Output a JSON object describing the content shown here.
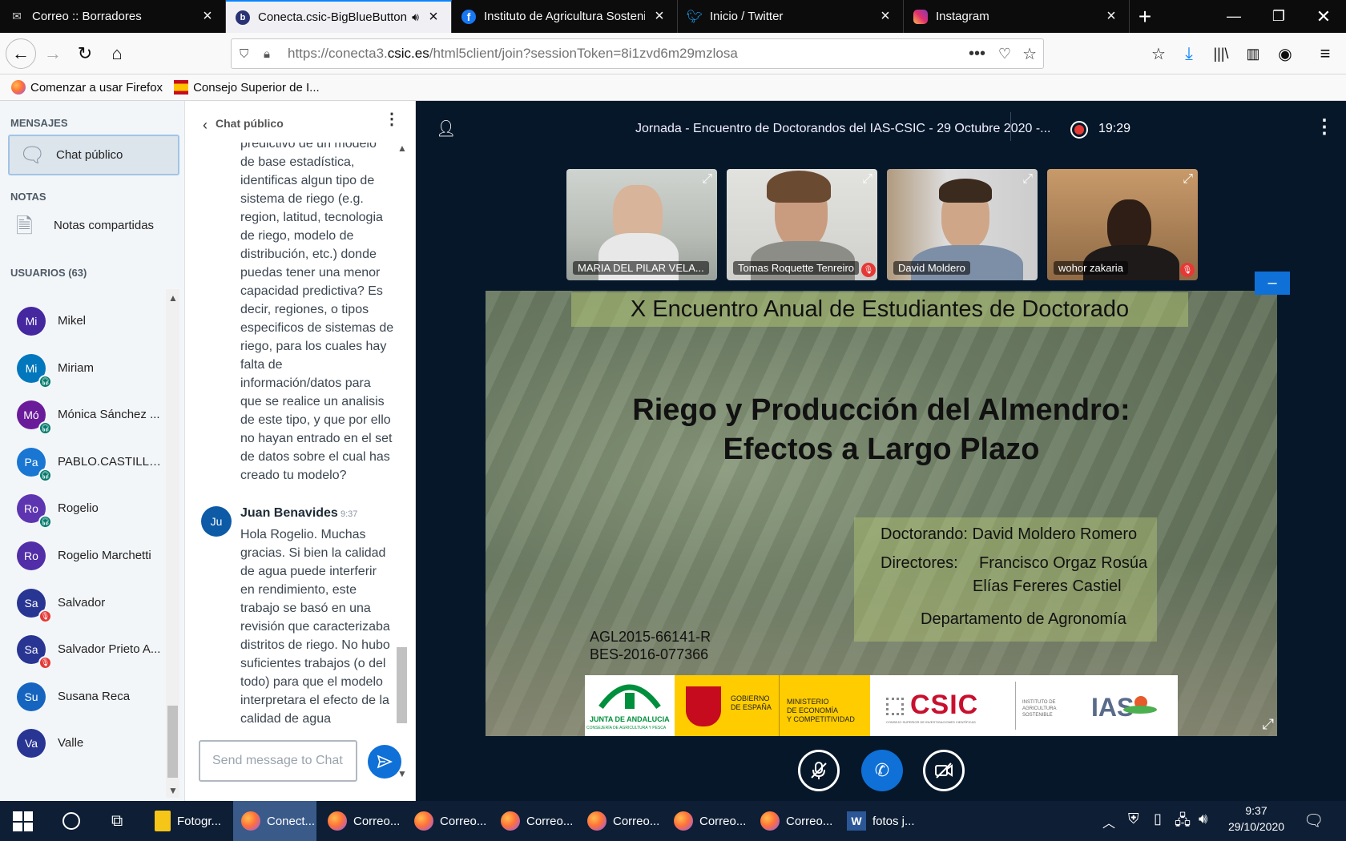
{
  "tabs": [
    {
      "title": "Correo :: Borradores",
      "icon": "mail-icon",
      "active": false
    },
    {
      "title": "Conecta.csic-BigBlueButton",
      "icon": "bigbluebutton-icon",
      "active": true
    },
    {
      "title": "Instituto de Agricultura Sostenible",
      "icon": "facebook-icon",
      "active": false
    },
    {
      "title": "Inicio / Twitter",
      "icon": "twitter-icon",
      "active": false
    },
    {
      "title": "Instagram",
      "icon": "instagram-icon",
      "active": false
    }
  ],
  "url": {
    "prefix": "https://conecta3.",
    "domain": "csic.es",
    "path": "/html5client/join?sessionToken=8i1zvd6m29mzlosa"
  },
  "bookmarks": [
    {
      "label": "Comenzar a usar Firefox",
      "icon": "firefox-icon"
    },
    {
      "label": "Consejo Superior de I...",
      "icon": "spain-flag-icon"
    }
  ],
  "sidebar": {
    "messages_header": "MENSAJES",
    "public_chat": "Chat público",
    "notes_header": "NOTAS",
    "shared_notes": "Notas compartidas",
    "users_header": "USUARIOS (63)",
    "users": [
      {
        "initials": "Mi",
        "name": "Mikel",
        "color": "#4527a0",
        "badge": ""
      },
      {
        "initials": "Mi",
        "name": "Miriam",
        "color": "#0277bd",
        "badge": "headset"
      },
      {
        "initials": "Mó",
        "name": "Mónica Sánchez ...",
        "color": "#6a1b9a",
        "badge": "headset"
      },
      {
        "initials": "Pa",
        "name": "PABLO.CASTILLO....",
        "color": "#1976d2",
        "badge": "headset"
      },
      {
        "initials": "Ro",
        "name": "Rogelio",
        "color": "#5e35b1",
        "badge": "headset"
      },
      {
        "initials": "Ro",
        "name": "Rogelio Marchetti",
        "color": "#512da8",
        "badge": ""
      },
      {
        "initials": "Sa",
        "name": "Salvador",
        "color": "#283593",
        "badge": "muted"
      },
      {
        "initials": "Sa",
        "name": "Salvador Prieto A...",
        "color": "#283593",
        "badge": "muted"
      },
      {
        "initials": "Su",
        "name": "Susana Reca",
        "color": "#1565c0",
        "badge": ""
      },
      {
        "initials": "Va",
        "name": "Valle",
        "color": "#283593",
        "badge": ""
      }
    ]
  },
  "chat": {
    "title": "Chat público",
    "previous_message": "predictivo de un modelo de base estadística, identificas algun tipo de sistema de riego (e.g. region, latitud, tecnologia de riego, modelo de distribución, etc.) donde puedas tener una menor capacidad predictiva? Es decir, regiones, o tipos especificos de sistemas de riego, para los cuales hay falta de información/datos para que se realice un analisis de este tipo, y que por ello no hayan entrado en el set de datos sobre el cual has creado tu modelo?",
    "previous_lines": [
      "predictivo de un modelo",
      "de base estadística,",
      "identificas algun tipo de",
      "sistema de riego (e.g.",
      "region, latitud, tecnologia",
      "de riego, modelo de",
      "distribución, etc.) donde",
      "puedas tener una menor",
      "capacidad predictiva? Es",
      "decir, regiones, o tipos",
      "especificos de sistemas de",
      "riego, para los cuales hay",
      "falta de",
      "información/datos para",
      "que se realice un analisis",
      "de este tipo, y que por ello",
      "no hayan entrado en el set",
      "de datos sobre el cual has",
      "creado tu modelo?"
    ],
    "message": {
      "initials": "Ju",
      "author": "Juan Benavides",
      "time": "9:37",
      "lines": [
        "Hola Rogelio. Muchas",
        "gracias. Si bien la calidad",
        "de agua puede interferir",
        "en rendimiento, este",
        "trabajo se basó en una",
        "revisión que caracterizaba",
        "distritos de riego. No hubo",
        "suficientes trabajos (o del",
        "todo) para que el modelo",
        "interpretara el efecto de la",
        "calidad de agua"
      ]
    },
    "input_placeholder": "Send message to Chat"
  },
  "meeting": {
    "title": "Jornada - Encuentro de Doctorandos del IAS-CSIC - 29 Octubre 2020 -...",
    "recording_time": "19:29",
    "videos": [
      {
        "name": "MARIA DEL PILAR VELA...",
        "muted": false
      },
      {
        "name": "Tomas Roquette Tenreiro",
        "muted": true
      },
      {
        "name": "David Moldero",
        "muted": false
      },
      {
        "name": "wohor zakaria",
        "muted": true
      }
    ]
  },
  "slide": {
    "header": "X Encuentro Anual de Estudiantes de Doctorado",
    "title_line1": "Riego y Producción del Almendro:",
    "title_line2": "Efectos a Largo Plazo",
    "doctorando": "Doctorando: David Moldero Romero",
    "directores_label": "Directores:",
    "director1": "Francisco Orgaz Rosúa",
    "director2": "Elías Fereres Castiel",
    "department": "Departamento de Agronomía",
    "code1": "AGL2015-66141-R",
    "code2": "BES-2016-077366",
    "logos": {
      "junta": "JUNTA DE ANDALUCIA",
      "junta_sub": "CONSEJERÍA DE AGRICULTURA Y PESCA",
      "gobierno": "GOBIERNO DE ESPAÑA",
      "ministerio_line1": "MINISTERIO",
      "ministerio_line2": "DE ECONOMÍA",
      "ministerio_line3": "Y COMPETITIVIDAD",
      "csic": "CSIC",
      "csic_sub": "CONSEJO SUPERIOR DE INVESTIGACIONES CIENTÍFICAS",
      "ias_small": "INSTITUTO DE AGRICULTURA SOSTENIBLE",
      "ias": "IAS"
    },
    "minimize": "–"
  },
  "taskbar": {
    "items": [
      {
        "label": "Fotogr...",
        "icon": "folder-icon"
      },
      {
        "label": "Conect...",
        "icon": "firefox-icon",
        "active": true
      },
      {
        "label": "Correo...",
        "icon": "firefox-icon"
      },
      {
        "label": "Correo...",
        "icon": "firefox-icon"
      },
      {
        "label": "Correo...",
        "icon": "firefox-icon"
      },
      {
        "label": "Correo...",
        "icon": "firefox-icon"
      },
      {
        "label": "Correo...",
        "icon": "firefox-icon"
      },
      {
        "label": "Correo...",
        "icon": "firefox-icon"
      },
      {
        "label": "fotos j...",
        "icon": "word-icon"
      }
    ],
    "time": "9:37",
    "date": "29/10/2020"
  },
  "colors": {
    "accent": "#0f70d7",
    "bbb_dark": "#06172a",
    "record": "#e53935"
  }
}
